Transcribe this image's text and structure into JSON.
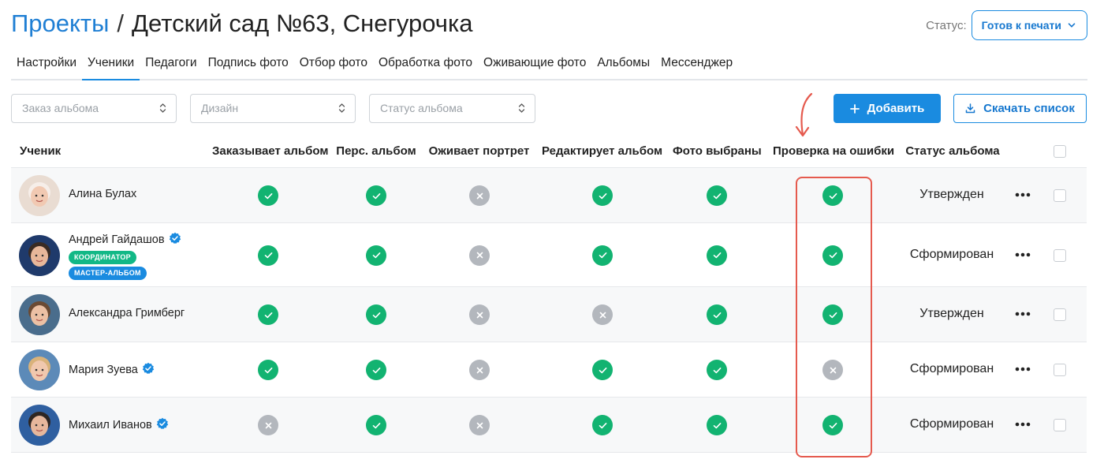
{
  "header": {
    "breadcrumb_root": "Проекты",
    "separator": "/",
    "project_title": "Детский сад №63, Снегурочка",
    "status_label": "Статус:",
    "status_value": "Готов к печати"
  },
  "tabs": [
    {
      "label": "Настройки",
      "active": false
    },
    {
      "label": "Ученики",
      "active": true
    },
    {
      "label": "Педагоги",
      "active": false
    },
    {
      "label": "Подпись фото",
      "active": false
    },
    {
      "label": "Отбор фото",
      "active": false
    },
    {
      "label": "Обработка фото",
      "active": false
    },
    {
      "label": "Оживающие фото",
      "active": false
    },
    {
      "label": "Альбомы",
      "active": false
    },
    {
      "label": "Мессенджер",
      "active": false
    }
  ],
  "filters": {
    "album_order_placeholder": "Заказ альбома",
    "design_placeholder": "Дизайн",
    "album_status_placeholder": "Статус альбома"
  },
  "actions": {
    "add_label": "Добавить",
    "download_label": "Скачать список"
  },
  "table": {
    "columns": {
      "student": "Ученик",
      "orders_album": "Заказывает альбом",
      "personal_album": "Перс. альбом",
      "animates_portrait": "Оживает портрет",
      "edits_album": "Редактирует альбом",
      "photos_selected": "Фото выбраны",
      "error_check": "Проверка на ошибки",
      "album_status": "Статус альбома"
    },
    "rows": [
      {
        "name": "Алина Булах",
        "verified": false,
        "badges": [],
        "checks": [
          true,
          true,
          false,
          true,
          true,
          true
        ],
        "status": "Утвержден"
      },
      {
        "name": "Андрей Гайдашов",
        "verified": true,
        "badges": [
          "КООРДИНАТОР",
          "МАСТЕР-АЛЬБОМ"
        ],
        "checks": [
          true,
          true,
          false,
          true,
          true,
          true
        ],
        "status": "Сформирован"
      },
      {
        "name": "Александра Гримберг",
        "verified": false,
        "badges": [],
        "checks": [
          true,
          true,
          false,
          false,
          true,
          true
        ],
        "status": "Утвержден"
      },
      {
        "name": "Мария Зуева",
        "verified": true,
        "badges": [],
        "checks": [
          true,
          true,
          false,
          true,
          true,
          false
        ],
        "status": "Сформирован"
      },
      {
        "name": "Михаил Иванов",
        "verified": true,
        "badges": [],
        "checks": [
          false,
          true,
          false,
          true,
          true,
          true
        ],
        "status": "Сформирован"
      }
    ]
  },
  "colors": {
    "accent": "#1a8be0",
    "ok": "#12b371",
    "no": "#b3b7bd",
    "highlight": "#e55a4e"
  }
}
